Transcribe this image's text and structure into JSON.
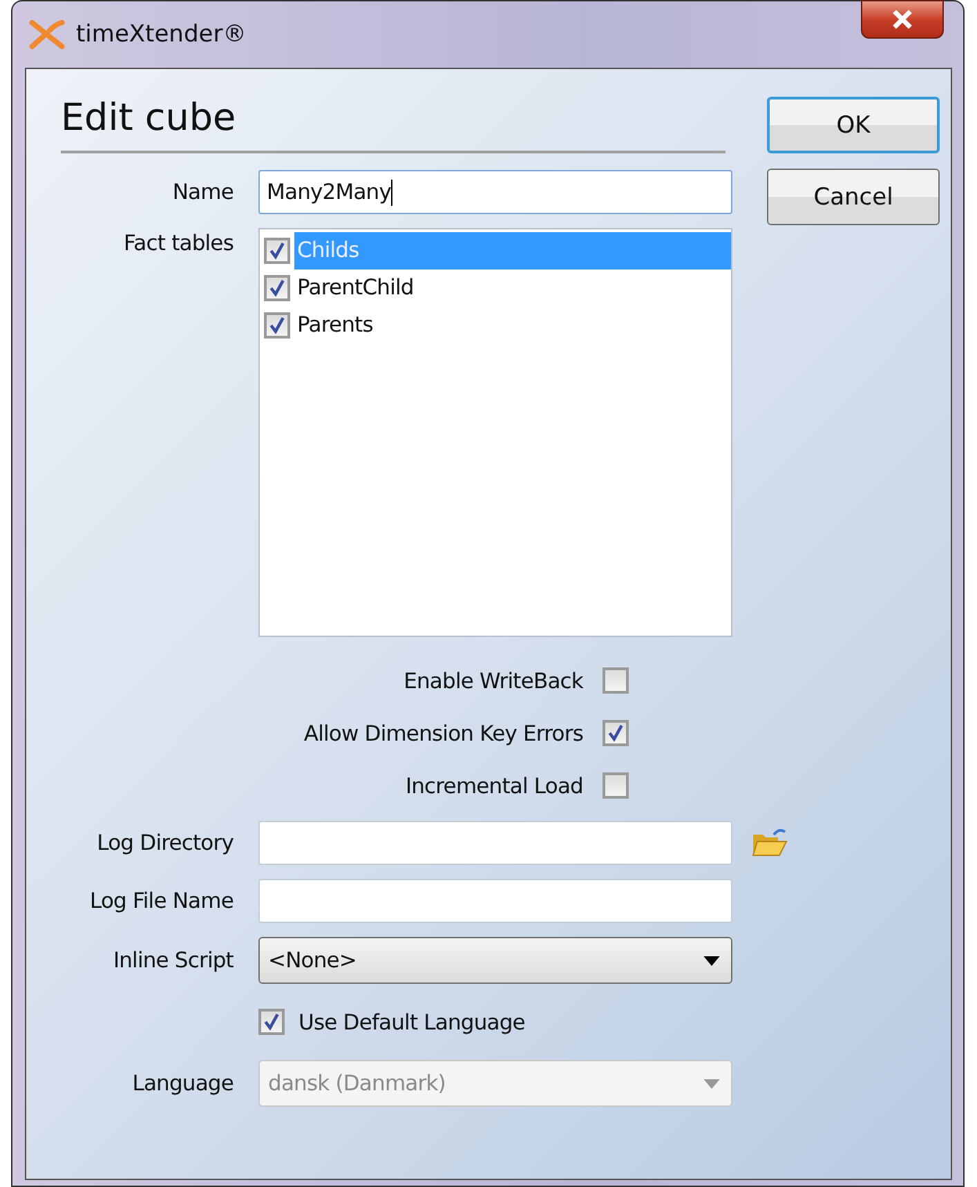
{
  "window": {
    "title": "timeXtender®"
  },
  "heading": "Edit cube",
  "buttons": [
    {
      "label": "OK",
      "default": true
    },
    {
      "label": "Cancel",
      "default": false
    }
  ],
  "name": {
    "label": "Name",
    "value": "Many2Many"
  },
  "fact_tables": {
    "label": "Fact tables",
    "items": [
      {
        "label": "Childs",
        "checked": true,
        "selected": true
      },
      {
        "label": "ParentChild",
        "checked": true,
        "selected": false
      },
      {
        "label": "Parents",
        "checked": true,
        "selected": false
      }
    ]
  },
  "options": [
    {
      "label": "Enable WriteBack",
      "checked": false
    },
    {
      "label": "Allow Dimension Key Errors",
      "checked": true
    },
    {
      "label": "Incremental Load",
      "checked": false
    }
  ],
  "log_directory": {
    "label": "Log Directory"
  },
  "log_file_name": {
    "label": "Log File Name"
  },
  "inline_script": {
    "label": "Inline Script",
    "value": "<None>"
  },
  "use_default_language": {
    "label": "Use Default Language",
    "checked": true
  },
  "language": {
    "label": "Language",
    "value": "dansk (Danmark)",
    "disabled": true
  }
}
